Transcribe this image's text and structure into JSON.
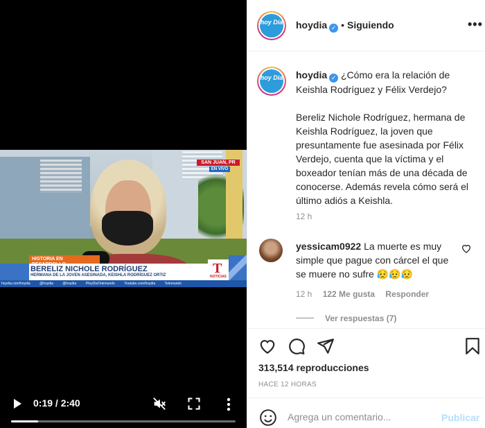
{
  "video": {
    "overlay": {
      "location": "SAN JUAN, PR",
      "live": "EN VIVO",
      "tag": "HISTORIA EN DESARROLLO",
      "name": "BERELIZ NICHOLE RODRÍGUEZ",
      "subtitle": "HERMANA DE LA JOVEN ASESINADA, KEISHLA RODRÍGUEZ ORTIZ",
      "logo_letter": "T",
      "logo_text": "NOTICIAS",
      "socials": [
        "hoydia.com/hoydia",
        "@hoydia",
        "@hoydia",
        "/HoyDiaTelemundo",
        "Youtube.com/hoydia",
        "Telemundo"
      ]
    },
    "controls": {
      "time": "0:19 / 2:40",
      "progress": 0.12,
      "icons": [
        "play-icon",
        "mute-icon",
        "fullscreen-icon",
        "more-vertical-icon"
      ]
    }
  },
  "post": {
    "header": {
      "avatar_text": "hoy Día",
      "username": "hoydia",
      "separator": "•",
      "follow_status": "Siguiendo",
      "more": "•••"
    },
    "caption": {
      "username": "hoydia",
      "first_line": "¿Cómo era la relación de Keishla Rodríguez y Félix Verdejo?",
      "body": "Bereliz Nichole Rodríguez, hermana de Keishla Rodríguez, la joven que presuntamente fue asesinada por Félix Verdejo, cuenta que la víctima y el boxeador tenían más de una década de conocerse. Además revela cómo será el último adiós a Keishla.",
      "age": "12 h"
    },
    "comment": {
      "username": "yessicam0922",
      "text": "La muerte es muy simple que pague con cárcel el que se muere no sufre 😥😥😥",
      "age": "12 h",
      "likes": "122 Me gusta",
      "reply": "Responder",
      "view_replies": "Ver respuestas (7)"
    },
    "stats": {
      "views": "313,514 reproducciones",
      "timestamp": "HACE 12 HORAS"
    },
    "comment_box": {
      "placeholder": "Agrega un comentario...",
      "publish": "Publicar"
    },
    "colors": {
      "verified": "#3897f0",
      "publish_disabled": "#b2dffc",
      "muted_text": "#8e8e8e"
    }
  }
}
